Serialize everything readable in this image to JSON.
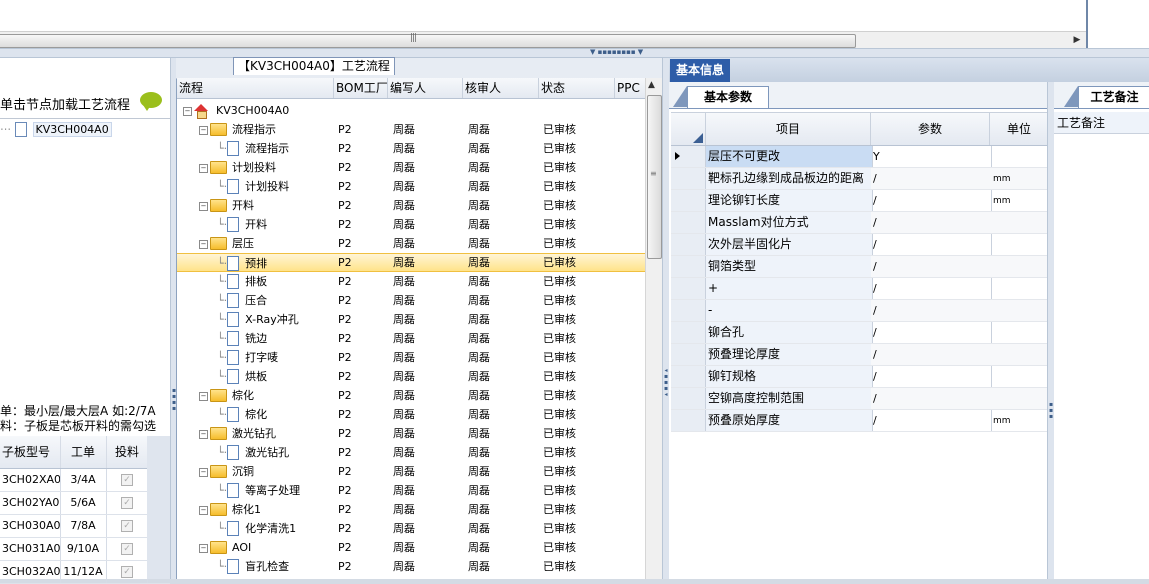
{
  "left": {
    "header_text": "单击节点加载工艺流程",
    "tree_node": "KV3CH004A0",
    "note_line1": "单：最小层/最大层A 如:2/7A",
    "note_line2": "料：子板是芯板开料的需勾选",
    "grid": {
      "headers": [
        "子板型号",
        "工单",
        "投料"
      ],
      "rows": [
        {
          "model": "3CH02XA0",
          "order": "3/4A",
          "checked": true
        },
        {
          "model": "3CH02YA0",
          "order": "5/6A",
          "checked": true
        },
        {
          "model": "3CH030A0",
          "order": "7/8A",
          "checked": true
        },
        {
          "model": "3CH031A0",
          "order": "9/10A",
          "checked": true
        },
        {
          "model": "3CH032A0",
          "order": "11/12A",
          "checked": true
        }
      ]
    }
  },
  "middle": {
    "caption": "【KV3CH004A0】工艺流程",
    "headers": [
      "流程",
      "BOM工厂",
      "编写人",
      "核审人",
      "状态",
      "PPC"
    ],
    "root": "KV3CH004A0",
    "rows": [
      {
        "name": "流程指示",
        "level": 1,
        "type": "folder",
        "bom": "P2",
        "writer": "周磊",
        "reviewer": "周磊",
        "status": "已审核"
      },
      {
        "name": "流程指示",
        "level": 2,
        "type": "doc",
        "bom": "P2",
        "writer": "周磊",
        "reviewer": "周磊",
        "status": "已审核"
      },
      {
        "name": "计划投料",
        "level": 1,
        "type": "folder",
        "bom": "P2",
        "writer": "周磊",
        "reviewer": "周磊",
        "status": "已审核"
      },
      {
        "name": "计划投料",
        "level": 2,
        "type": "doc",
        "bom": "P2",
        "writer": "周磊",
        "reviewer": "周磊",
        "status": "已审核"
      },
      {
        "name": "开料",
        "level": 1,
        "type": "folder",
        "bom": "P2",
        "writer": "周磊",
        "reviewer": "周磊",
        "status": "已审核"
      },
      {
        "name": "开料",
        "level": 2,
        "type": "doc",
        "bom": "P2",
        "writer": "周磊",
        "reviewer": "周磊",
        "status": "已审核"
      },
      {
        "name": "层压",
        "level": 1,
        "type": "folder",
        "bom": "P2",
        "writer": "周磊",
        "reviewer": "周磊",
        "status": "已审核"
      },
      {
        "name": "预排",
        "level": 2,
        "type": "doc",
        "bom": "P2",
        "writer": "周磊",
        "reviewer": "周磊",
        "status": "已审核",
        "selected": true
      },
      {
        "name": "排板",
        "level": 2,
        "type": "doc",
        "bom": "P2",
        "writer": "周磊",
        "reviewer": "周磊",
        "status": "已审核"
      },
      {
        "name": "压合",
        "level": 2,
        "type": "doc",
        "bom": "P2",
        "writer": "周磊",
        "reviewer": "周磊",
        "status": "已审核"
      },
      {
        "name": "X-Ray冲孔",
        "level": 2,
        "type": "doc",
        "bom": "P2",
        "writer": "周磊",
        "reviewer": "周磊",
        "status": "已审核"
      },
      {
        "name": "铣边",
        "level": 2,
        "type": "doc",
        "bom": "P2",
        "writer": "周磊",
        "reviewer": "周磊",
        "status": "已审核"
      },
      {
        "name": "打字唛",
        "level": 2,
        "type": "doc",
        "bom": "P2",
        "writer": "周磊",
        "reviewer": "周磊",
        "status": "已审核"
      },
      {
        "name": "烘板",
        "level": 2,
        "type": "doc",
        "bom": "P2",
        "writer": "周磊",
        "reviewer": "周磊",
        "status": "已审核"
      },
      {
        "name": "棕化",
        "level": 1,
        "type": "folder",
        "bom": "P2",
        "writer": "周磊",
        "reviewer": "周磊",
        "status": "已审核"
      },
      {
        "name": "棕化",
        "level": 2,
        "type": "doc",
        "bom": "P2",
        "writer": "周磊",
        "reviewer": "周磊",
        "status": "已审核"
      },
      {
        "name": "激光钻孔",
        "level": 1,
        "type": "folder",
        "bom": "P2",
        "writer": "周磊",
        "reviewer": "周磊",
        "status": "已审核"
      },
      {
        "name": "激光钻孔",
        "level": 2,
        "type": "doc",
        "bom": "P2",
        "writer": "周磊",
        "reviewer": "周磊",
        "status": "已审核"
      },
      {
        "name": "沉铜",
        "level": 1,
        "type": "folder",
        "bom": "P2",
        "writer": "周磊",
        "reviewer": "周磊",
        "status": "已审核"
      },
      {
        "name": "等离子处理",
        "level": 2,
        "type": "doc",
        "bom": "P2",
        "writer": "周磊",
        "reviewer": "周磊",
        "status": "已审核"
      },
      {
        "name": "棕化1",
        "level": 1,
        "type": "folder",
        "bom": "P2",
        "writer": "周磊",
        "reviewer": "周磊",
        "status": "已审核"
      },
      {
        "name": "化学清洗1",
        "level": 2,
        "type": "doc",
        "bom": "P2",
        "writer": "周磊",
        "reviewer": "周磊",
        "status": "已审核"
      },
      {
        "name": "AOI",
        "level": 1,
        "type": "folder",
        "bom": "P2",
        "writer": "周磊",
        "reviewer": "周磊",
        "status": "已审核"
      },
      {
        "name": "盲孔检查",
        "level": 2,
        "type": "doc",
        "bom": "P2",
        "writer": "周磊",
        "reviewer": "周磊",
        "status": "已审核"
      }
    ]
  },
  "right": {
    "tab": "基本信息",
    "subtab": "基本参数",
    "headers": [
      "项目",
      "参数",
      "单位"
    ],
    "rows": [
      {
        "item": "层压不可更改",
        "value": "Y",
        "unit": "",
        "current": true
      },
      {
        "item": "靶标孔边缘到成品板边的距离",
        "value": "/",
        "unit": "mm"
      },
      {
        "item": "理论铆钉长度",
        "value": "/",
        "unit": "mm"
      },
      {
        "item": "Masslam对位方式",
        "value": "/",
        "unit": ""
      },
      {
        "item": "次外层半固化片",
        "value": "/",
        "unit": ""
      },
      {
        "item": "铜箔类型",
        "value": "/",
        "unit": ""
      },
      {
        "item": "+",
        "value": "/",
        "unit": ""
      },
      {
        "item": "-",
        "value": "/",
        "unit": ""
      },
      {
        "item": "铆合孔",
        "value": "/",
        "unit": ""
      },
      {
        "item": "预叠理论厚度",
        "value": "/",
        "unit": ""
      },
      {
        "item": "铆钉规格",
        "value": "/",
        "unit": ""
      },
      {
        "item": "空铆高度控制范围",
        "value": "/",
        "unit": ""
      },
      {
        "item": "预叠原始厚度",
        "value": "/",
        "unit": "mm"
      }
    ],
    "notes_tab": "工艺备注",
    "notes_header": "工艺备注"
  },
  "icons": {
    "collapse": "minus-expander-icon",
    "folder": "folder-icon",
    "doc": "document-icon",
    "home": "home-icon",
    "chat": "speech-bubble-icon"
  }
}
